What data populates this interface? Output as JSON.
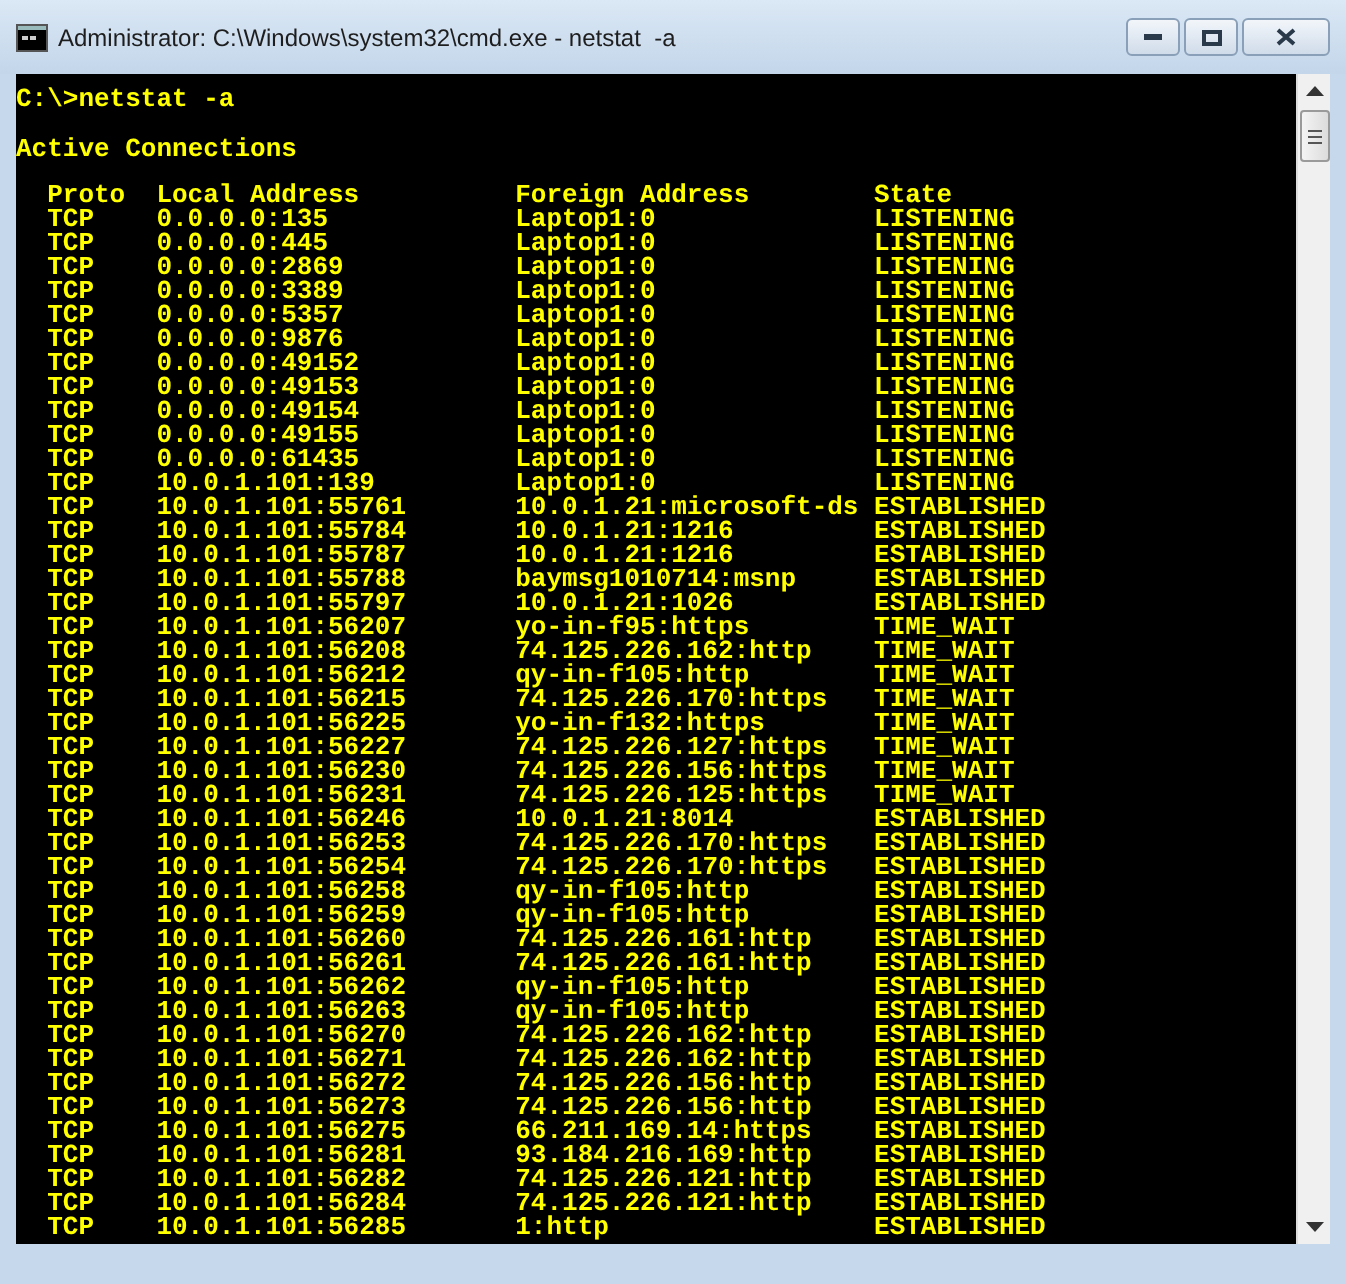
{
  "window": {
    "title": "Administrator: C:\\Windows\\system32\\cmd.exe - netstat  -a"
  },
  "console": {
    "prompt": "C:\\>netstat -a",
    "heading": "Active Connections",
    "columns": [
      "Proto",
      "Local Address",
      "Foreign Address",
      "State"
    ],
    "rows": [
      [
        "TCP",
        "0.0.0.0:135",
        "Laptop1:0",
        "LISTENING"
      ],
      [
        "TCP",
        "0.0.0.0:445",
        "Laptop1:0",
        "LISTENING"
      ],
      [
        "TCP",
        "0.0.0.0:2869",
        "Laptop1:0",
        "LISTENING"
      ],
      [
        "TCP",
        "0.0.0.0:3389",
        "Laptop1:0",
        "LISTENING"
      ],
      [
        "TCP",
        "0.0.0.0:5357",
        "Laptop1:0",
        "LISTENING"
      ],
      [
        "TCP",
        "0.0.0.0:9876",
        "Laptop1:0",
        "LISTENING"
      ],
      [
        "TCP",
        "0.0.0.0:49152",
        "Laptop1:0",
        "LISTENING"
      ],
      [
        "TCP",
        "0.0.0.0:49153",
        "Laptop1:0",
        "LISTENING"
      ],
      [
        "TCP",
        "0.0.0.0:49154",
        "Laptop1:0",
        "LISTENING"
      ],
      [
        "TCP",
        "0.0.0.0:49155",
        "Laptop1:0",
        "LISTENING"
      ],
      [
        "TCP",
        "0.0.0.0:61435",
        "Laptop1:0",
        "LISTENING"
      ],
      [
        "TCP",
        "10.0.1.101:139",
        "Laptop1:0",
        "LISTENING"
      ],
      [
        "TCP",
        "10.0.1.101:55761",
        "10.0.1.21:microsoft-ds",
        "ESTABLISHED"
      ],
      [
        "TCP",
        "10.0.1.101:55784",
        "10.0.1.21:1216",
        "ESTABLISHED"
      ],
      [
        "TCP",
        "10.0.1.101:55787",
        "10.0.1.21:1216",
        "ESTABLISHED"
      ],
      [
        "TCP",
        "10.0.1.101:55788",
        "baymsg1010714:msnp",
        "ESTABLISHED"
      ],
      [
        "TCP",
        "10.0.1.101:55797",
        "10.0.1.21:1026",
        "ESTABLISHED"
      ],
      [
        "TCP",
        "10.0.1.101:56207",
        "yo-in-f95:https",
        "TIME_WAIT"
      ],
      [
        "TCP",
        "10.0.1.101:56208",
        "74.125.226.162:http",
        "TIME_WAIT"
      ],
      [
        "TCP",
        "10.0.1.101:56212",
        "qy-in-f105:http",
        "TIME_WAIT"
      ],
      [
        "TCP",
        "10.0.1.101:56215",
        "74.125.226.170:https",
        "TIME_WAIT"
      ],
      [
        "TCP",
        "10.0.1.101:56225",
        "yo-in-f132:https",
        "TIME_WAIT"
      ],
      [
        "TCP",
        "10.0.1.101:56227",
        "74.125.226.127:https",
        "TIME_WAIT"
      ],
      [
        "TCP",
        "10.0.1.101:56230",
        "74.125.226.156:https",
        "TIME_WAIT"
      ],
      [
        "TCP",
        "10.0.1.101:56231",
        "74.125.226.125:https",
        "TIME_WAIT"
      ],
      [
        "TCP",
        "10.0.1.101:56246",
        "10.0.1.21:8014",
        "ESTABLISHED"
      ],
      [
        "TCP",
        "10.0.1.101:56253",
        "74.125.226.170:https",
        "ESTABLISHED"
      ],
      [
        "TCP",
        "10.0.1.101:56254",
        "74.125.226.170:https",
        "ESTABLISHED"
      ],
      [
        "TCP",
        "10.0.1.101:56258",
        "qy-in-f105:http",
        "ESTABLISHED"
      ],
      [
        "TCP",
        "10.0.1.101:56259",
        "qy-in-f105:http",
        "ESTABLISHED"
      ],
      [
        "TCP",
        "10.0.1.101:56260",
        "74.125.226.161:http",
        "ESTABLISHED"
      ],
      [
        "TCP",
        "10.0.1.101:56261",
        "74.125.226.161:http",
        "ESTABLISHED"
      ],
      [
        "TCP",
        "10.0.1.101:56262",
        "qy-in-f105:http",
        "ESTABLISHED"
      ],
      [
        "TCP",
        "10.0.1.101:56263",
        "qy-in-f105:http",
        "ESTABLISHED"
      ],
      [
        "TCP",
        "10.0.1.101:56270",
        "74.125.226.162:http",
        "ESTABLISHED"
      ],
      [
        "TCP",
        "10.0.1.101:56271",
        "74.125.226.162:http",
        "ESTABLISHED"
      ],
      [
        "TCP",
        "10.0.1.101:56272",
        "74.125.226.156:http",
        "ESTABLISHED"
      ],
      [
        "TCP",
        "10.0.1.101:56273",
        "74.125.226.156:http",
        "ESTABLISHED"
      ],
      [
        "TCP",
        "10.0.1.101:56275",
        "66.211.169.14:https",
        "ESTABLISHED"
      ],
      [
        "TCP",
        "10.0.1.101:56281",
        "93.184.216.169:http",
        "ESTABLISHED"
      ],
      [
        "TCP",
        "10.0.1.101:56282",
        "74.125.226.121:http",
        "ESTABLISHED"
      ],
      [
        "TCP",
        "10.0.1.101:56284",
        "74.125.226.121:http",
        "ESTABLISHED"
      ],
      [
        "TCP",
        "10.0.1.101:56285",
        "1:http",
        "ESTABLISHED"
      ]
    ]
  }
}
